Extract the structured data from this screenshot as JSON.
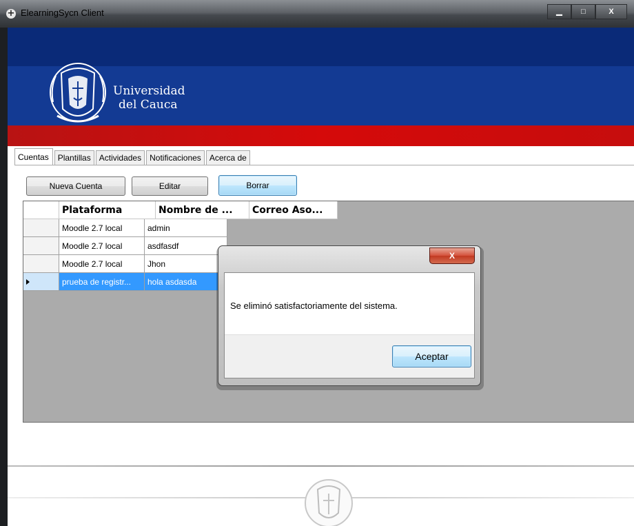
{
  "window": {
    "title": "ElearningSycn Client",
    "minimize_label": "▁",
    "maximize_label": "□",
    "close_label": "X"
  },
  "banner": {
    "university_line1": "Universidad",
    "university_line2": "del Cauca",
    "colors": {
      "dark_blue": "#0a2a78",
      "blue": "#133a93",
      "red": "#d50a0a"
    }
  },
  "tabs": [
    {
      "label": "Cuentas",
      "active": true
    },
    {
      "label": "Plantillas"
    },
    {
      "label": "Actividades"
    },
    {
      "label": "Notificaciones"
    },
    {
      "label": "Acerca de"
    }
  ],
  "toolbar": {
    "new_account": "Nueva Cuenta",
    "edit": "Editar",
    "delete": "Borrar"
  },
  "grid": {
    "columns": [
      "Plataforma",
      "Nombre de ...",
      "Correo Aso..."
    ],
    "rows": [
      {
        "platform": "Moodle 2.7 local",
        "name": "admin"
      },
      {
        "platform": "Moodle 2.7 local",
        "name": "asdfasdf"
      },
      {
        "platform": "Moodle 2.7 local",
        "name": "Jhon"
      },
      {
        "platform": "prueba de registr...",
        "name": "hola asdasda",
        "selected": true
      }
    ]
  },
  "dialog": {
    "close_label": "X",
    "message": "Se eliminó satisfactoriamente del sistema.",
    "ok_label": "Aceptar"
  }
}
